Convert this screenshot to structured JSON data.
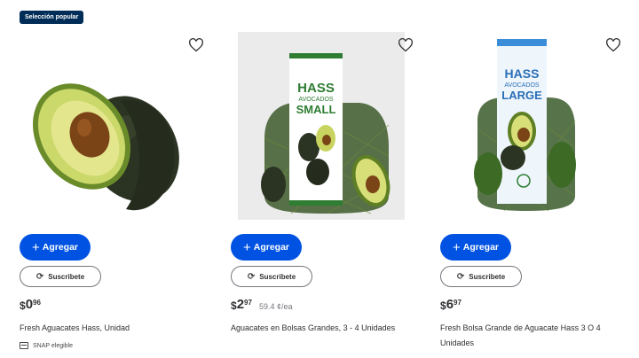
{
  "products": [
    {
      "badge": "Selección popular",
      "currency": "$",
      "dollars": "0",
      "cents": "96",
      "unit_price": "",
      "title": "Fresh Aguacates Hass, Unidad",
      "snap": "SNAP elegible"
    },
    {
      "badge": "",
      "currency": "$",
      "dollars": "2",
      "cents": "97",
      "unit_price": "59.4 ¢/ea",
      "title": "Aguacates en Bolsas Grandes, 3 - 4 Unidades",
      "snap": "",
      "package": {
        "line1": "HASS",
        "line2": "AVOCADOS",
        "line3": "SMALL"
      }
    },
    {
      "badge": "",
      "currency": "$",
      "dollars": "6",
      "cents": "97",
      "unit_price": "",
      "title": "Fresh Bolsa Grande de Aguacate Hass 3 O 4 Unidades",
      "snap": "",
      "package": {
        "line1": "HASS",
        "line2": "AVOCADOS",
        "line3": "LARGE"
      }
    }
  ],
  "buttons": {
    "add_label": "Agregar",
    "subscribe_label": "Suscribete"
  },
  "colors": {
    "primary": "#0053e2",
    "badge_bg": "#002d58",
    "text": "#2e2f32",
    "muted": "#74767c",
    "brand_green": "#2e7d32"
  },
  "icons": {
    "favorite": "heart-outline-icon",
    "add": "plus-icon",
    "subscribe": "sync-icon",
    "snap": "card-icon"
  }
}
